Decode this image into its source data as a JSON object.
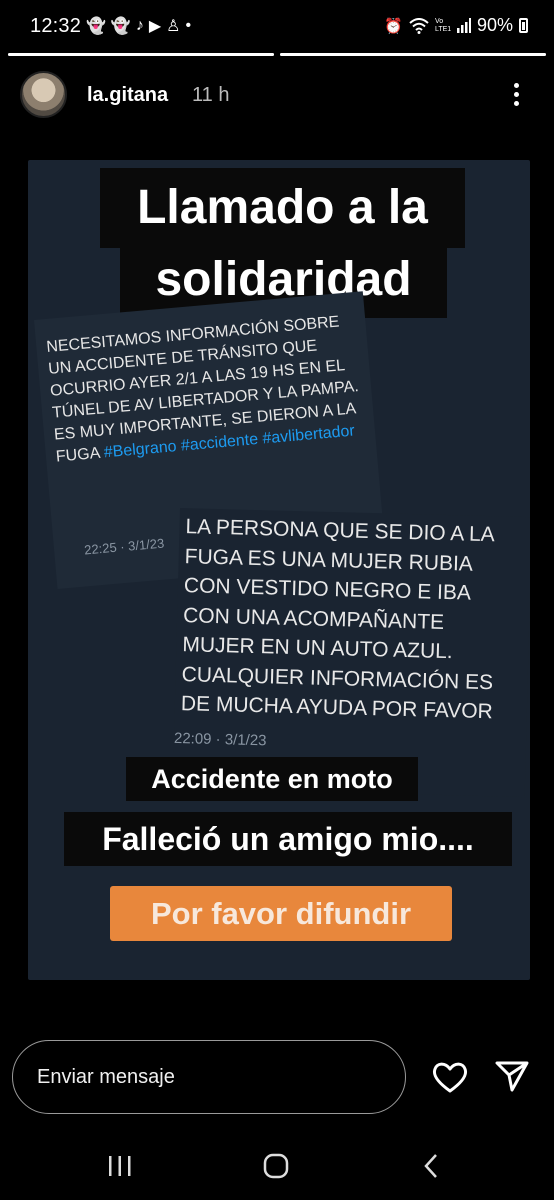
{
  "status_bar": {
    "time": "12:32",
    "notification_icons": [
      "snapchat-icon",
      "snapchat-icon",
      "tiktok-icon",
      "youtube-icon",
      "app-icon",
      "dot"
    ],
    "network_label": "Vo LTE1",
    "battery": "90%"
  },
  "story_progress": [
    1.0,
    1.0
  ],
  "header": {
    "username": "la.gitana",
    "time_ago": "11 h"
  },
  "story": {
    "title_line1": "Llamado a la",
    "title_line2": "solidaridad",
    "tweet1": {
      "text": "NECESITAMOS INFORMACIÓN SOBRE UN ACCIDENTE DE TRÁNSITO QUE OCURRIO AYER 2/1 A LAS 19 hs EN EL TÚNEL DE AV LIBERTADOR Y LA PAMPA. ES MUY IMPORTANTE, SE DIERON A LA FUGA",
      "hashtags": "#Belgrano #accidente #avlibertador",
      "timestamp": "22:25 · 3/1/23"
    },
    "tweet2": {
      "text": "LA PERSONA QUE SE DIO A LA FUGA ES UNA MUJER RUBIA CON VESTIDO NEGRO E IBA CON UNA ACOMPAÑANTE MUJER EN UN AUTO AZUL. CUALQUIER INFORMACIÓN ES DE MUCHA AYUDA POR FAVOR",
      "timestamp": "22:09 · 3/1/23"
    },
    "caption1": "Accidente en moto",
    "caption2": "Falleció un amigo mio....",
    "caption3": "Por favor difundir",
    "caption3_color": "#e8873c"
  },
  "reply": {
    "placeholder": "Enviar mensaje"
  }
}
